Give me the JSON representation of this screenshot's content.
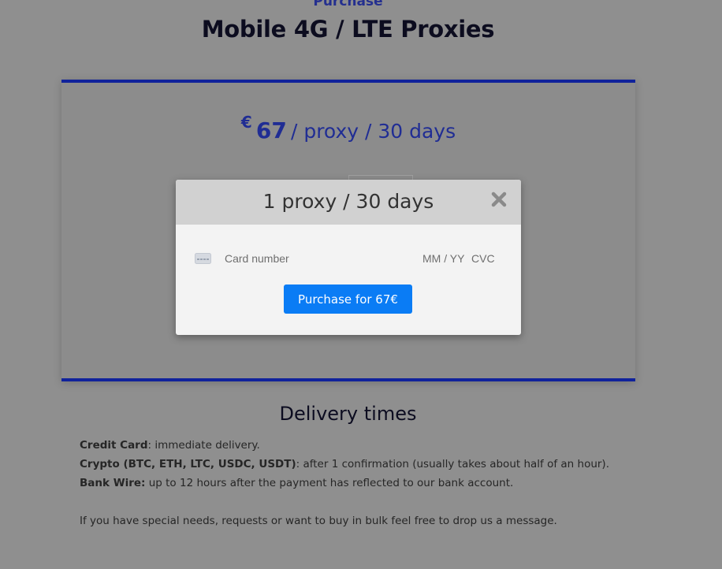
{
  "page": {
    "eyebrow": "Purchase",
    "title": "Mobile 4G / LTE Proxies"
  },
  "pricing": {
    "currency": "€",
    "amount": "67",
    "period": "/ proxy / 30 days"
  },
  "modal": {
    "title": "1 proxy / 30 days",
    "card_placeholder": "Card number",
    "expiry_placeholder": "MM / YY",
    "cvc_placeholder": "CVC",
    "purchase_label": "Purchase for 67€"
  },
  "delivery": {
    "title": "Delivery times",
    "lines": [
      {
        "label": "Credit Card",
        "text": ": immediate delivery."
      },
      {
        "label": "Crypto (BTC, ETH, LTC, USDC, USDT)",
        "text": ": after 1 confirmation (usually takes about half of an hour)."
      },
      {
        "label": "Bank Wire:",
        "text": " up to 12 hours after the payment has reflected to our bank account."
      }
    ],
    "note": "If you have special needs, requests or want to buy in bulk feel free to drop us a message."
  },
  "colors": {
    "accent": "#10229b",
    "button": "#0a7cf5",
    "overlay": "#8f8f8f"
  },
  "icons": [
    "close-icon",
    "credit-card-icon"
  ]
}
